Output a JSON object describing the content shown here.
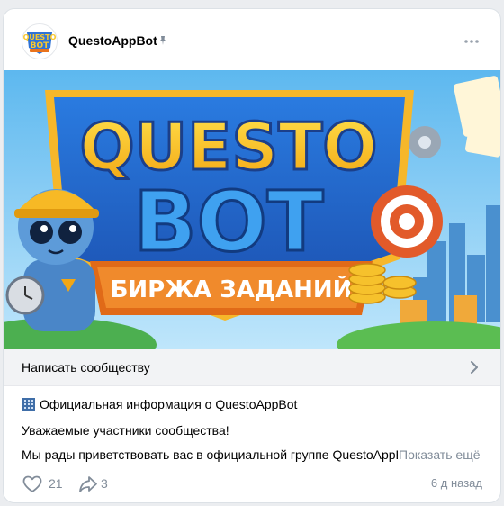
{
  "post": {
    "author": "QuestoAppBot",
    "pinned_icon": "pin-icon",
    "menu_icon": "more-dots-icon"
  },
  "banner": {
    "logo_top": "QUESTO",
    "logo_bottom": "BOT",
    "ribbon": "БИРЖА ЗАДАНИЙ",
    "avatar_top": "QUESTO",
    "avatar_bottom": "BOT",
    "avatar_sub": "БИРЖА ЗАДАНИЙ"
  },
  "cta": {
    "label": "Написать сообществу"
  },
  "content": {
    "title_emoji": "building-icon",
    "title": "Официальная информация о QuestoAppBot",
    "line1": "Уважаемые участники сообщества!",
    "line2": "Мы рады приветствовать вас в официальной группе QuestoAppBot",
    "show_more": "Показать ещё"
  },
  "footer": {
    "likes": "21",
    "shares": "3",
    "time": "6 д назад"
  },
  "colors": {
    "accent_blue": "#2a5fb8",
    "gold": "#f7c22b",
    "ribbon_orange": "#e9731c",
    "muted": "#818c99"
  }
}
